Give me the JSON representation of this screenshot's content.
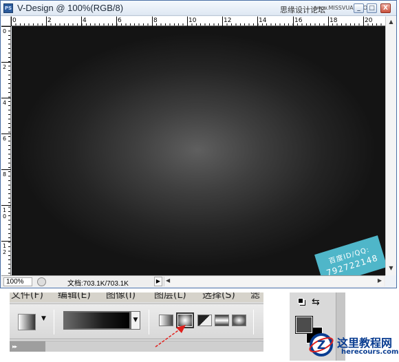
{
  "window": {
    "app_icon": "PS",
    "title": "V-Design @ 100%(RGB/8)",
    "watermark_cn": "思缘设计论坛",
    "watermark_url": "www.MISSVUAN.COM",
    "btn_min": "_",
    "btn_max": "□",
    "btn_close": "X"
  },
  "rulers": {
    "h_labels": [
      "0",
      "2",
      "4",
      "6",
      "8",
      "10",
      "12",
      "14",
      "16",
      "18",
      "20"
    ],
    "v_labels": [
      "0",
      "2",
      "4",
      "6",
      "8",
      "1\n0",
      "1\n2"
    ]
  },
  "canvas": {
    "stamp_line1": "百度ID/QQ:",
    "stamp_line2": "792722148",
    "colors": {
      "center": "#5f5f5f",
      "edge": "#141414"
    }
  },
  "scroll": {
    "up": "▲",
    "down": "▼",
    "left": "◀",
    "right": "▶"
  },
  "status": {
    "zoom": "100%",
    "doc_info": "文档:703.1K/703.1K",
    "menu_arrow": "▶"
  },
  "menu": {
    "items": [
      "文件(F)",
      "编辑(E)",
      "图像(I)",
      "图层(L)",
      "选择(S)",
      "滤"
    ]
  },
  "options": {
    "preset_arrow": "▼",
    "picker_arrow": "▼",
    "selected_type": "radial",
    "types": [
      "linear",
      "radial",
      "angle",
      "reflected",
      "diamond"
    ]
  },
  "panel": {
    "tab_glyph": "▸▸"
  },
  "swatches": {
    "swap_glyph": "⇆",
    "foreground": "#4c4c4c",
    "background": "#000000"
  },
  "logo": {
    "cn": "这里教程网",
    "en": "herecours.com",
    "mark": "Z"
  }
}
